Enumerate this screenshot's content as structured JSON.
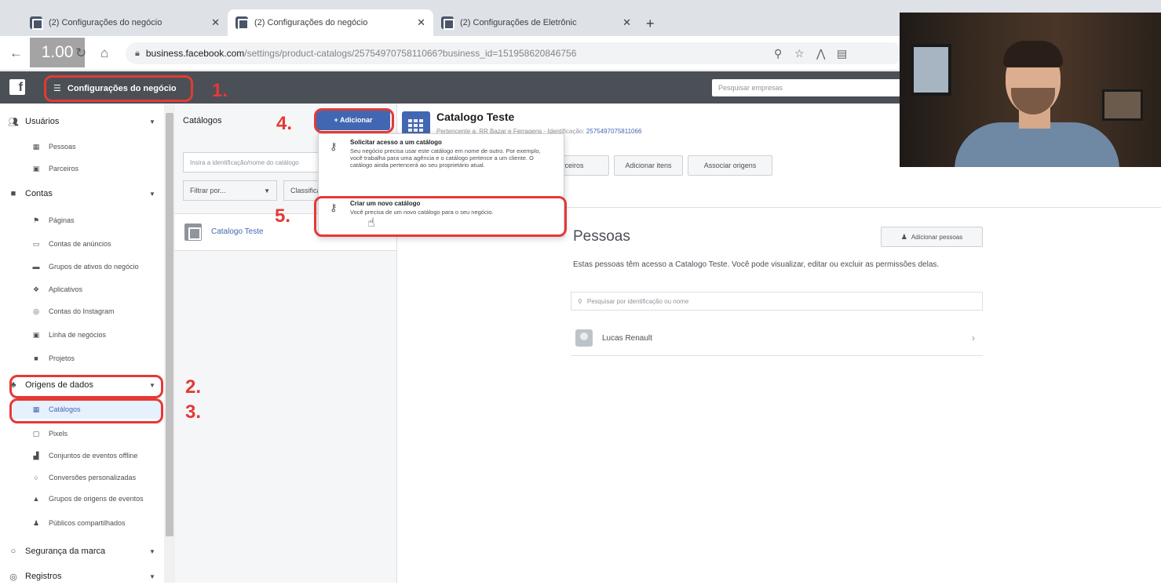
{
  "browser": {
    "tabs": [
      {
        "label": "(2) Configurações do negócio",
        "active": false
      },
      {
        "label": "(2) Configurações do negócio",
        "active": true
      },
      {
        "label": "(2) Configurações de Eletrônic",
        "active": false
      }
    ],
    "new_tab": "+",
    "url_host": "business.facebook.com",
    "url_path": "/settings/product-catalogs/2575497075811066?business_id=151958620846756",
    "playback_speed": "1.00"
  },
  "fb_bar": {
    "logo": "f",
    "settings_label": "Configurações do negócio",
    "business_search_placeholder": "Pesquisar empresas"
  },
  "sidebar": {
    "users": {
      "label": "Usuários",
      "items": [
        "Pessoas",
        "Parceiros"
      ]
    },
    "accounts": {
      "label": "Contas",
      "items": [
        "Páginas",
        "Contas de anúncios",
        "Grupos de ativos do negócio",
        "Aplicativos",
        "Contas do Instagram",
        "Linha de negócios",
        "Projetos"
      ]
    },
    "data_sources": {
      "label": "Origens de dados",
      "items": [
        "Catálogos",
        "Pixels",
        "Conjuntos de eventos offline",
        "Conversões personalizadas",
        "Grupos de origens de eventos",
        "Públicos compartilhados"
      ]
    },
    "brand_safety": {
      "label": "Segurança da marca"
    },
    "registrations": {
      "label": "Registros"
    }
  },
  "catalog_panel": {
    "title": "Catálogos",
    "add_button": "+ Adicionar",
    "search_placeholder": "Insira a identificação/nome do catálogo",
    "filter_label": "Filtrar por...",
    "sort_label": "Classificar por...",
    "catalog_name": "Catalogo Teste"
  },
  "details": {
    "title": "Catalogo Teste",
    "owner_line": "Pertencente a: RR Bazar e Ferragens",
    "id_label": "Identificação:",
    "id_value": "2575497075811066",
    "buttons": [
      "Adicionar parceiros",
      "Adicionar itens",
      "Associar origens"
    ]
  },
  "dropdown": {
    "options": [
      {
        "title": "Solicitar acesso a um catálogo",
        "desc": "Seu negócio precisa usar este catálogo em nome de outro. Por exemplo, você trabalha para uma agência e o catálogo pertence a um cliente. O catálogo ainda pertencerá ao seu proprietário atual."
      },
      {
        "title": "Criar um novo catálogo",
        "desc": "Você precisa de um novo catálogo para o seu negócio."
      }
    ]
  },
  "people": {
    "title": "Pessoas",
    "add_button": "Adicionar pessoas",
    "description": "Estas pessoas têm acesso a Catalogo Teste. Você pode visualizar, editar ou excluir as permissões delas.",
    "search_placeholder": "Pesquisar por identificação ou nome",
    "rows": [
      {
        "name": "Lucas Renault"
      }
    ]
  },
  "annotations": {
    "steps": [
      "1.",
      "2.",
      "3.",
      "4.",
      "5."
    ],
    "color": "#e53935"
  },
  "colors": {
    "fb_bar": "#4b4f56",
    "accent": "#4267b2",
    "active_bg": "#e7f0fd"
  }
}
